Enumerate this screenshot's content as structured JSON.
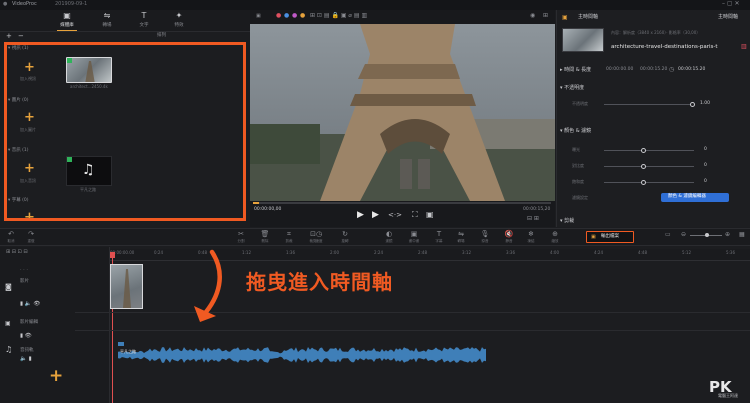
{
  "app": {
    "name": "VideoProc",
    "project": "201909-09-1"
  },
  "library": {
    "tabs": [
      {
        "label": "媒體庫",
        "icon": "media-library-icon"
      },
      {
        "label": "轉場",
        "icon": "transition-icon"
      },
      {
        "label": "文字",
        "icon": "text-icon"
      },
      {
        "label": "特效",
        "icon": "effects-icon"
      }
    ],
    "sort_label": "排列",
    "sections": [
      {
        "title": "視訊",
        "count": "(1)",
        "add_label": "加入視訊"
      },
      {
        "title": "圖片",
        "count": "(0)",
        "add_label": "加入圖片"
      },
      {
        "title": "音訊",
        "count": "(1)",
        "add_label": "加入音訊"
      },
      {
        "title": "字幕",
        "count": "(0)",
        "add_label": ""
      }
    ],
    "video_item_name": "architect...2450.4k",
    "audio_item_name": "平凡之路"
  },
  "player": {
    "time": "00:00:00,00",
    "duration": "00:00:15,20"
  },
  "inspector": {
    "tab_label": "主時間軸",
    "tab_right": "主時間軸",
    "resolution_info": "內容：解析度（3840 x 2160）· 影格率（30,00）",
    "clip_name": "architecture-travel-destinations-paris-t",
    "time_section": "時間 & 長度",
    "time_in": "00:00:00.00",
    "time_out": "00:00:15.20",
    "time_total": "00:00:15.20",
    "opacity_section": "不透明度",
    "opacity_label": "不透明度",
    "opacity_value": "1.00",
    "color_section": "顏色 & 濾鏡",
    "color_rows": [
      {
        "label": "曝光",
        "value": "0"
      },
      {
        "label": "對比度",
        "value": "0"
      },
      {
        "label": "飽和度",
        "value": "0"
      }
    ],
    "filter_label": "濾鏡設定",
    "color_button": "顏色 & 濾鏡編輯器",
    "crop_section": "剪裁",
    "export_button": "輸出檔案"
  },
  "timeline": {
    "tools": [
      "取消",
      "重做",
      "分割",
      "刪除",
      "剪裁",
      "裁剪",
      "速度",
      "旋轉",
      "濾鏡",
      "畫中畫",
      "字幕",
      "轉場",
      "錄音",
      "靜音",
      "凍結",
      "縮放"
    ],
    "ruler": [
      "00:00:00.00",
      "0:24",
      "0:48",
      "1:12",
      "1:36",
      "2:00",
      "2:24",
      "2:48",
      "3:12",
      "3:36",
      "4:00",
      "4:24",
      "4:48",
      "5:12",
      "5:36"
    ],
    "tracks": [
      "影片",
      "影片編輯",
      "音訊軌"
    ],
    "audio_clip_label": "平凡之路"
  },
  "annotation": {
    "text": "拖曳進入時間軸"
  },
  "watermark": {
    "letters": "PK",
    "sub": "電腦王阿達"
  },
  "colors": {
    "accent": "#f05a22",
    "waveform": "#3f7fb8",
    "brand_yellow": "#e6a23c",
    "button_blue": "#2f6fd6"
  }
}
